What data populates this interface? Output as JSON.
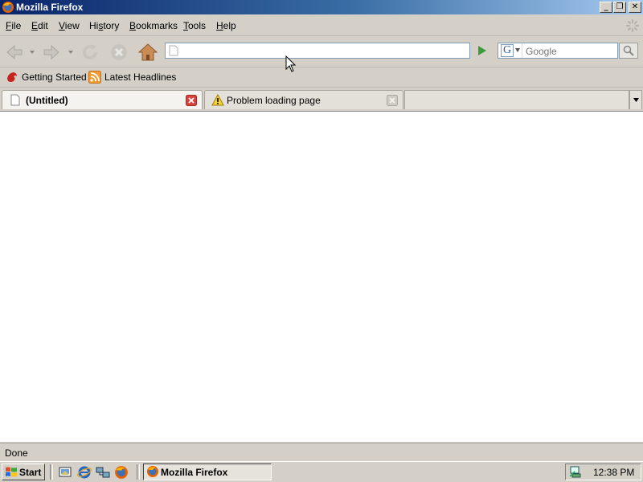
{
  "window": {
    "title": "Mozilla Firefox",
    "min_glyph": "_",
    "restore_glyph": "❐",
    "close_glyph": "✕"
  },
  "menu": {
    "items": [
      "File",
      "Edit",
      "View",
      "History",
      "Bookmarks",
      "Tools",
      "Help"
    ],
    "underline_letters": [
      "F",
      "E",
      "V",
      "s",
      "B",
      "T",
      "H"
    ]
  },
  "navbar": {
    "url_value": "",
    "search_placeholder": "Google",
    "search_engine": "G"
  },
  "bookmarks": {
    "items": [
      {
        "label": "Getting Started",
        "icon": "firefox-red-icon"
      },
      {
        "label": "Latest Headlines",
        "icon": "rss-feed-icon"
      }
    ]
  },
  "tabs": [
    {
      "label": "(Untitled)",
      "selected": true,
      "icon": "blank-page-icon"
    },
    {
      "label": "Problem loading page",
      "selected": false,
      "icon": "warning-icon"
    }
  ],
  "status": {
    "text": "Done"
  },
  "taskbar": {
    "start_label": "Start",
    "task_label": "Mozilla Firefox",
    "clock": "12:38 PM"
  },
  "colors": {
    "titlebar_start": "#0a246a",
    "titlebar_end": "#a6caf0",
    "chrome": "#d4d0c8",
    "close_red": "#d9413a",
    "go_green": "#3a9d3a"
  }
}
